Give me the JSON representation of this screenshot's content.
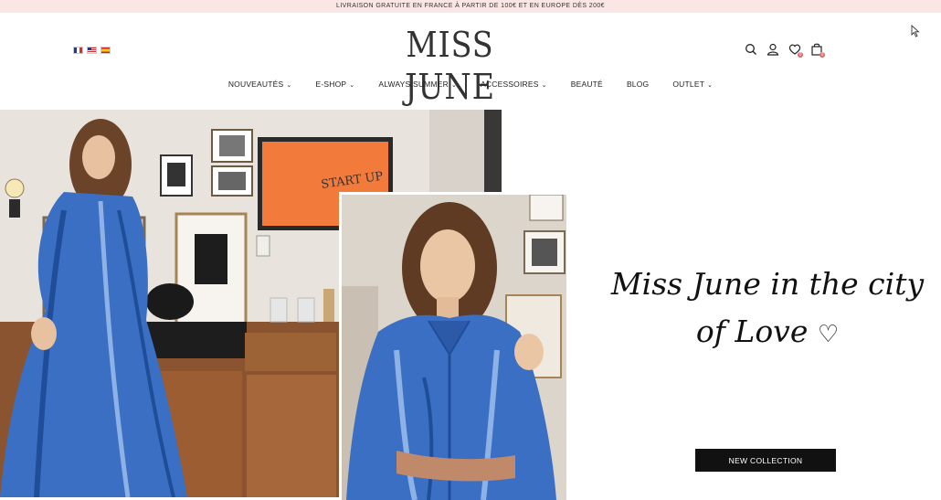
{
  "promo_bar": {
    "text": "LIVRAISON GRATUITE EN FRANCE À PARTIR DE 100€ ET EN EUROPE DÈS 200€"
  },
  "header": {
    "languages": [
      {
        "code": "fr",
        "icon": "french-flag-icon"
      },
      {
        "code": "en",
        "icon": "us-flag-icon"
      },
      {
        "code": "es",
        "icon": "spanish-flag-icon"
      }
    ],
    "logo_text": "MISS JUNE",
    "icons": {
      "search": "search-icon",
      "account": "user-icon",
      "wishlist": "heart-icon",
      "cart": "shopping-bag-icon",
      "wishlist_count": "0",
      "cart_count": "0"
    }
  },
  "nav": {
    "items": [
      {
        "label": "NOUVEAUTÉS",
        "has_dropdown": true
      },
      {
        "label": "E-SHOP",
        "has_dropdown": true
      },
      {
        "label": "ALWAYS SUMMER",
        "has_dropdown": true
      },
      {
        "label": "ACCESSOIRES",
        "has_dropdown": true
      },
      {
        "label": "BEAUTÉ",
        "has_dropdown": false
      },
      {
        "label": "BLOG",
        "has_dropdown": false
      },
      {
        "label": "OUTLET",
        "has_dropdown": true
      }
    ]
  },
  "hero": {
    "tagline_line1": "Miss June in the city",
    "tagline_line2": "of Love",
    "tagline_heart": "♡",
    "cta_label": "NEW COLLECTION",
    "wall_art_text": "START UP"
  },
  "colors": {
    "promo_bg": "#fbe6e6",
    "cta_bg": "#111111",
    "dress_blue": "#3a6fc4",
    "art_orange": "#f27b3c"
  }
}
